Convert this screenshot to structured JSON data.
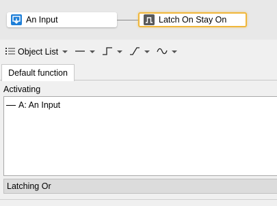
{
  "canvas": {
    "input_node": {
      "label": "An Input",
      "icon": "input-block-icon"
    },
    "latch_node": {
      "label": "Latch On Stay On",
      "icon": "latch-pulse-icon",
      "highlight_color": "#f0b73a"
    }
  },
  "toolbar": {
    "object_list_label": "Object List",
    "object_list_icon": "list-icon",
    "signal_types": [
      "constant-line-icon",
      "step-edge-icon",
      "ramp-edge-icon",
      "wave-icon"
    ]
  },
  "tabs": {
    "default_function": "Default function"
  },
  "activating": {
    "label": "Activating",
    "items": [
      {
        "text": "A: An Input"
      }
    ]
  },
  "footer": {
    "latching_or": "Latching Or"
  }
}
